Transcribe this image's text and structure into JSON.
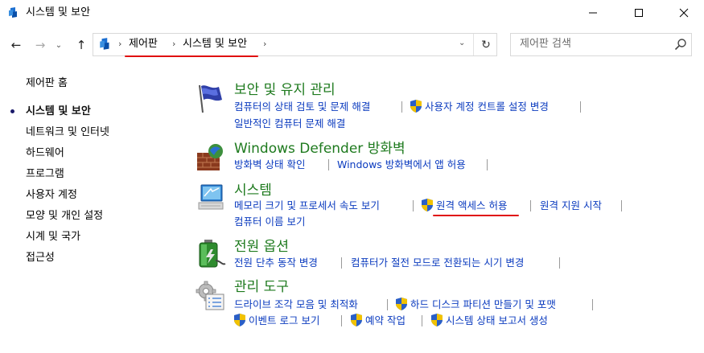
{
  "window": {
    "title": "시스템 및 보안"
  },
  "address": {
    "crumbs": [
      "제어판",
      "시스템 및 보안"
    ],
    "search_placeholder": "제어판 검색"
  },
  "sidebar": {
    "home": "제어판 홈",
    "active": "시스템 및 보안",
    "items": [
      "네트워크 및 인터넷",
      "하드웨어",
      "프로그램",
      "사용자 계정",
      "모양 및 개인 설정",
      "시계 및 국가",
      "접근성"
    ]
  },
  "sections": {
    "security": {
      "title": "보안 및 유지 관리",
      "links": [
        "컴퓨터의 상태 검토 및 문제 해결",
        "사용자 계정 컨트롤 설정 변경",
        "일반적인 컴퓨터 문제 해결"
      ]
    },
    "firewall": {
      "title": "Windows Defender 방화벽",
      "links": [
        "방화벽 상태 확인",
        "Windows 방화벽에서 앱 허용"
      ]
    },
    "system": {
      "title": "시스템",
      "links": [
        "메모리 크기 및 프로세서 속도 보기",
        "원격 액세스 허용",
        "원격 지원 시작",
        "컴퓨터 이름 보기"
      ]
    },
    "power": {
      "title": "전원 옵션",
      "links": [
        "전원 단추 동작 변경",
        "컴퓨터가 절전 모드로 전환되는 시기 변경"
      ]
    },
    "admin": {
      "title": "관리 도구",
      "links": [
        "드라이브 조각 모음 및 최적화",
        "하드 디스크 파티션 만들기 및 포맷",
        "이벤트 로그 보기",
        "예약 작업",
        "시스템 상태 보고서 생성"
      ]
    }
  },
  "colors": {
    "section_title": "#1e7a1e",
    "link": "#0b3bbf",
    "annotation": "#e01010"
  }
}
